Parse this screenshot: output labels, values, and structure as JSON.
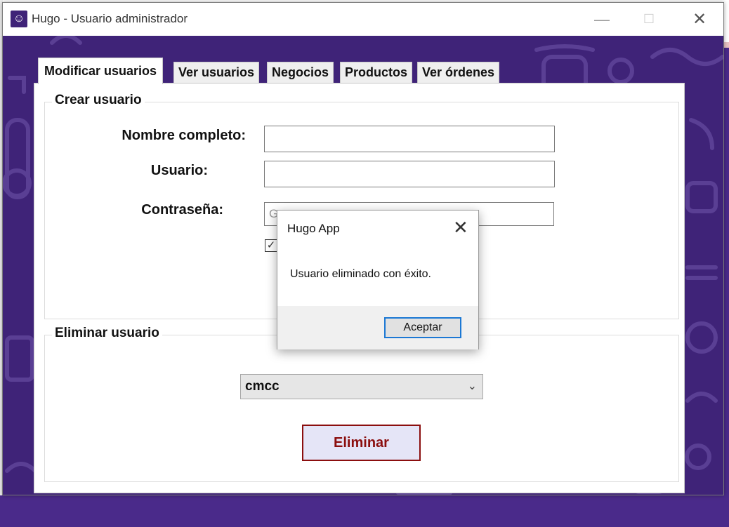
{
  "window": {
    "title": "Hugo - Usuario administrador",
    "minimize": "—",
    "maximize": "☐",
    "close": "✕"
  },
  "tabs": [
    {
      "label": "Modificar usuarios",
      "active": true
    },
    {
      "label": "Ver usuarios"
    },
    {
      "label": "Negocios"
    },
    {
      "label": "Productos"
    },
    {
      "label": "Ver órdenes"
    }
  ],
  "create_user": {
    "title": "Crear usuario",
    "name_label": "Nombre completo:",
    "name_value": "",
    "user_label": "Usuario:",
    "user_value": "",
    "password_label": "Contraseña:",
    "password_placeholder": "G",
    "checkbox_checked": true
  },
  "delete_user": {
    "title": "Eliminar usuario",
    "selected_user": "cmcc",
    "delete_label": "Eliminar"
  },
  "dialog": {
    "title": "Hugo App",
    "message": "Usuario eliminado con éxito.",
    "ok_label": "Aceptar",
    "close": "✕"
  },
  "colors": {
    "window_bg": "#3f2378",
    "danger": "#8b0e0e",
    "focus": "#1c78d4"
  }
}
